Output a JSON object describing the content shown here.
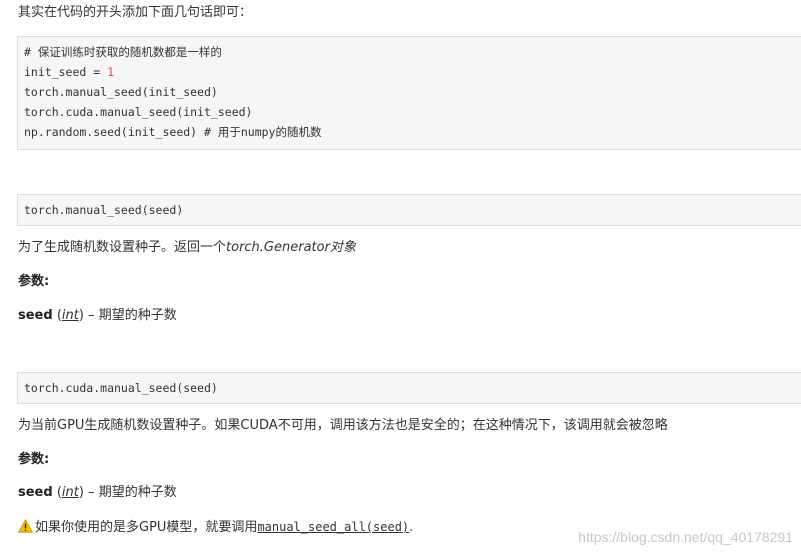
{
  "intro": "其实在代码的开头添加下面几句话即可：",
  "code1": {
    "comment": "# 保证训练时获取的随机数都是一样的",
    "line2_prefix": "init_seed = ",
    "line2_value": "1",
    "line3": "torch.manual_seed(init_seed)",
    "line4": "torch.cuda.manual_seed(init_seed)",
    "line5": "np.random.seed(init_seed) # 用于numpy的随机数"
  },
  "section1": {
    "signature": "torch.manual_seed(seed)",
    "desc_prefix": "为了生成随机数设置种子。返回一个",
    "desc_italic": "torch.Generator对象",
    "params_label": "参数:",
    "param_name": "seed",
    "param_type": "int",
    "param_desc": " – 期望的种子数"
  },
  "section2": {
    "signature": "torch.cuda.manual_seed(seed)",
    "desc": "为当前GPU生成随机数设置种子。如果CUDA不可用，调用该方法也是安全的；在这种情况下，该调用就会被忽略",
    "params_label": "参数:",
    "param_name": "seed",
    "param_type": "int",
    "param_desc": " – 期望的种子数",
    "warning_prefix": "如果你使用的是多GPU模型，就要调用",
    "warning_code": "manual_seed_all(seed)",
    "warning_suffix": "."
  },
  "watermark": "https://blog.csdn.net/qq_40178291",
  "icons": {
    "warning": "warning-icon"
  },
  "colors": {
    "number": "#d14c4c",
    "code_bg": "#f6f6f6",
    "warning": "#f5c400"
  }
}
